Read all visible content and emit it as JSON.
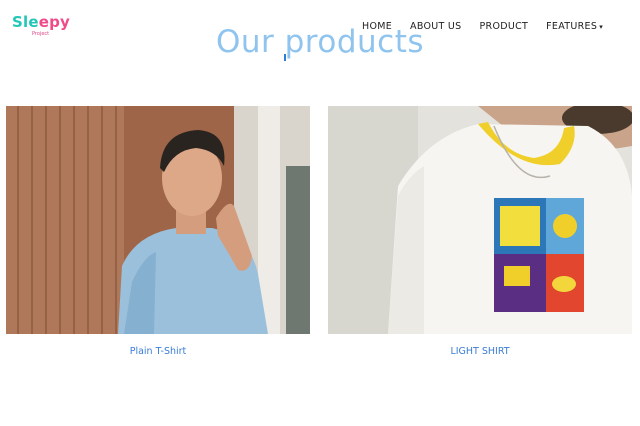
{
  "brand": {
    "name_part1": "Sle",
    "name_part2": "epy",
    "tagline": "Project"
  },
  "nav": {
    "items": [
      "HOME",
      "ABOUT US",
      "PRODUCT",
      "FEATURES"
    ],
    "features_caret": "▾"
  },
  "page": {
    "title": "Our products"
  },
  "products": [
    {
      "name": "Plain T-Shirt"
    },
    {
      "name": "LIGHT SHIRT"
    }
  ],
  "colors": {
    "brand_teal": "#22c7b8",
    "brand_pink": "#f04a8a",
    "title": "#8fc4ef",
    "link": "#3a7dd6"
  }
}
